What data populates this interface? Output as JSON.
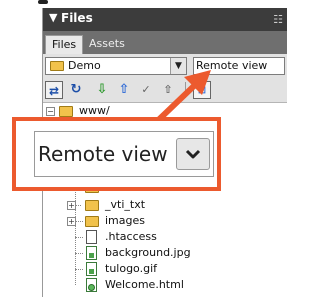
{
  "panel": {
    "title": "Files",
    "title_arrow": "▼",
    "options_icon": "☷"
  },
  "tabs": [
    {
      "label": "Files",
      "active": true
    },
    {
      "label": "Assets",
      "active": false
    }
  ],
  "site_select": {
    "value": "Demo"
  },
  "view_select": {
    "value": "Remote view"
  },
  "zoom": {
    "value": "Remote view"
  },
  "toolbar": {
    "connect_icon": "⇄",
    "refresh_icon": "↻",
    "get_icon": "⇩",
    "put_icon": "⇧",
    "checkout_icon": "✓",
    "checkin_icon": "⇧",
    "expand_icon": "⊞"
  },
  "tree": {
    "root": {
      "label": "www/",
      "expander": "−"
    },
    "items": [
      {
        "label": "_vti_txt",
        "type": "folder",
        "expander": "+"
      },
      {
        "label": "images",
        "type": "folder",
        "expander": "+"
      },
      {
        "label": ".htaccess",
        "type": "file"
      },
      {
        "label": "background.jpg",
        "type": "image"
      },
      {
        "label": "tulogo.gif",
        "type": "image"
      },
      {
        "label": "Welcome.html",
        "type": "html"
      }
    ]
  },
  "colors": {
    "callout_orange": "#ec5a2e",
    "title_bar": "#3c3c3c",
    "tab_bar": "#6f6f6f",
    "folder": "#f1c24b"
  }
}
